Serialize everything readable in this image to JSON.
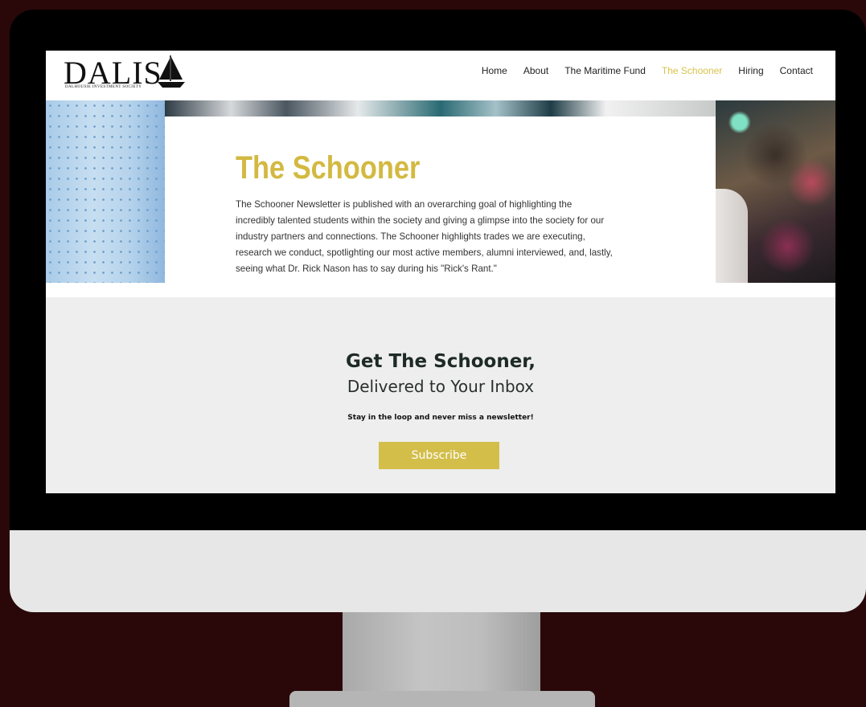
{
  "site": {
    "logo_text": "DALIS",
    "logo_subtext": "DALHOUSIE INVESTMENT SOCIETY"
  },
  "nav": {
    "items": [
      {
        "label": "Home",
        "active": false
      },
      {
        "label": "About",
        "active": false
      },
      {
        "label": "The Maritime Fund",
        "active": false
      },
      {
        "label": "The Schooner",
        "active": true
      },
      {
        "label": "Hiring",
        "active": false
      },
      {
        "label": "Contact",
        "active": false
      }
    ]
  },
  "hero": {
    "title": "The Schooner",
    "body": "The Schooner Newsletter is published with an overarching goal of highlighting the incredibly talented students within the society and giving a glimpse into the society for our industry partners and connections. The Schooner highlights trades we are executing, research we conduct, spotlighting our most active members, alumni interviewed, and, lastly, seeing what Dr. Rick Nason has to say during his \"Rick's Rant.\""
  },
  "subscribe_section": {
    "title": "Get The Schooner,",
    "subtitle": "Delivered to Your Inbox",
    "tagline": "Stay in the loop and never miss a newsletter!",
    "button_label": "Subscribe"
  },
  "colors": {
    "accent_gold": "#d3be4a",
    "background": "#2a0809",
    "section_gray": "#eeeeee"
  },
  "icons": {
    "logo_mark": "sailboat-icon"
  }
}
